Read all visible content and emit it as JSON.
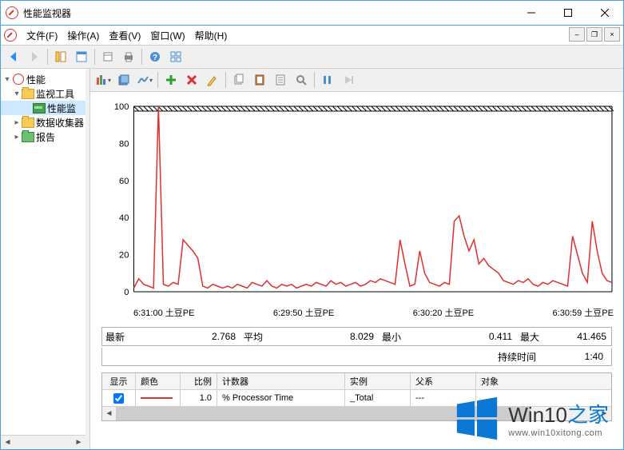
{
  "window": {
    "title": "性能监视器"
  },
  "menu": {
    "file": "文件(F)",
    "action": "操作(A)",
    "view": "查看(V)",
    "window": "窗口(W)",
    "help": "帮助(H)"
  },
  "tree": {
    "root": "性能",
    "monitor_tools": "监视工具",
    "perf_monitor": "性能监",
    "data_collectors": "数据收集器",
    "reports": "报告"
  },
  "chart_data": {
    "type": "line",
    "title": "",
    "ylabel": "",
    "xlabel": "",
    "ylim": [
      0,
      100
    ],
    "yticks": [
      0,
      20,
      40,
      60,
      80,
      100
    ],
    "x_labels": [
      "6:31:00 土豆PE",
      "6:29:50 土豆PE",
      "6:30:20 土豆PE",
      "6:30:59 土豆PE"
    ],
    "series": [
      {
        "name": "% Processor Time",
        "color": "#e03030",
        "values": [
          2,
          7,
          4,
          3,
          2,
          100,
          4,
          3,
          5,
          4,
          28,
          25,
          22,
          18,
          3,
          2,
          4,
          3,
          2,
          3,
          2,
          4,
          3,
          2,
          5,
          4,
          3,
          6,
          3,
          2,
          4,
          3,
          4,
          2,
          3,
          4,
          3,
          5,
          4,
          3,
          6,
          4,
          5,
          3,
          4,
          5,
          3,
          4,
          6,
          5,
          7,
          6,
          5,
          4,
          28,
          15,
          3,
          4,
          22,
          10,
          5,
          4,
          3,
          5,
          4,
          38,
          41,
          30,
          22,
          28,
          15,
          18,
          14,
          12,
          10,
          6,
          5,
          4,
          6,
          5,
          7,
          4,
          3,
          5,
          4,
          6,
          5,
          4,
          3,
          30,
          20,
          10,
          5,
          38,
          22,
          10,
          6,
          5
        ]
      }
    ]
  },
  "stats": {
    "last_label": "最新",
    "last_value": "2.768",
    "avg_label": "平均",
    "avg_value": "8.029",
    "min_label": "最小",
    "min_value": "0.411",
    "max_label": "最大",
    "max_value": "41.465",
    "duration_label": "持续时间",
    "duration_value": "1:40"
  },
  "counter_table": {
    "headers": {
      "show": "显示",
      "color": "颜色",
      "scale": "比例",
      "counter": "计数器",
      "instance": "实例",
      "parent": "父系",
      "object": "对象"
    },
    "row": {
      "show": true,
      "scale": "1.0",
      "counter": "% Processor Time",
      "instance": "_Total",
      "parent": "---",
      "object": ""
    }
  },
  "watermark": {
    "brand_a": "Win10",
    "brand_b": "之家",
    "url": "www.win10xitong.com"
  }
}
